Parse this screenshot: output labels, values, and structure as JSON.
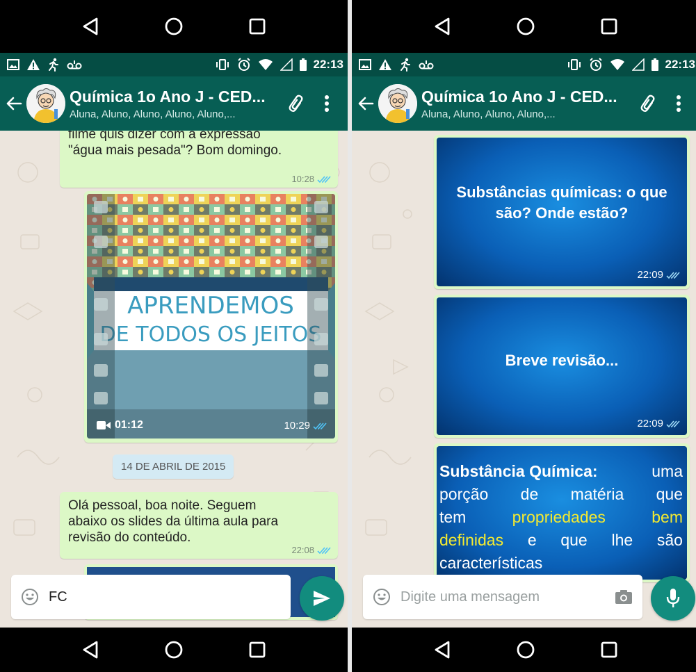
{
  "nav": {
    "back": "back",
    "home": "home",
    "recents": "recents"
  },
  "status": {
    "time": "22:13"
  },
  "chat": {
    "title": "Química 1o Ano J - CED...",
    "subtitle": "Aluna, Aluno, Aluno, Aluno, Aluno,...",
    "subtitle_right": "Aluna, Aluno, Aluno, Aluno,..."
  },
  "left": {
    "msg1": {
      "line1": "filme quis dizer com a expressão",
      "line2": "\"água mais pesada\"? Bom domingo.",
      "time": "10:28"
    },
    "video": {
      "title_line1": "APRENDEMOS",
      "title_line2": "DE TODOS OS JEITOS",
      "duration": "01:12",
      "time": "10:29"
    },
    "date": "14 DE ABRIL DE 2015",
    "msg2": {
      "line1": "Olá pessoal, boa noite. Seguem",
      "line2": "abaixo os slides da última aula para",
      "line3": "revisão do conteúdo.",
      "time": "22:08"
    },
    "input_value": "FC"
  },
  "right": {
    "slide1": {
      "line1": "Substâncias químicas: o que",
      "line2": "são? Onde estão?",
      "time": "22:09"
    },
    "slide2": {
      "text": "Breve revisão...",
      "time": "22:09"
    },
    "slide3": {
      "w1": "Substância",
      "w2": "Química:",
      "w3": "uma",
      "w4": "porção",
      "w5": "de",
      "w6": "matéria",
      "w7": "que",
      "w8": "tem",
      "w9": "propriedades",
      "w10": "bem",
      "w11": "definidas",
      "w12": "e",
      "w13": "que",
      "w14": "lhe",
      "w15": "são",
      "w16": "características"
    },
    "input_placeholder": "Digite uma mensagem"
  },
  "colors": {
    "header": "#075e54",
    "status": "#054d44",
    "bubble": "#dcf8c6",
    "accent": "#128c7e",
    "tick": "#4fc3f7",
    "slide_yellow": "#f4ea30"
  },
  "icons": [
    "back-triangle-icon",
    "home-circle-icon",
    "recents-square-icon",
    "arrow-back-icon",
    "paperclip-icon",
    "more-vert-icon",
    "emoji-icon",
    "send-icon",
    "mic-icon",
    "camera-icon",
    "double-check-icon",
    "video-camera-icon"
  ]
}
